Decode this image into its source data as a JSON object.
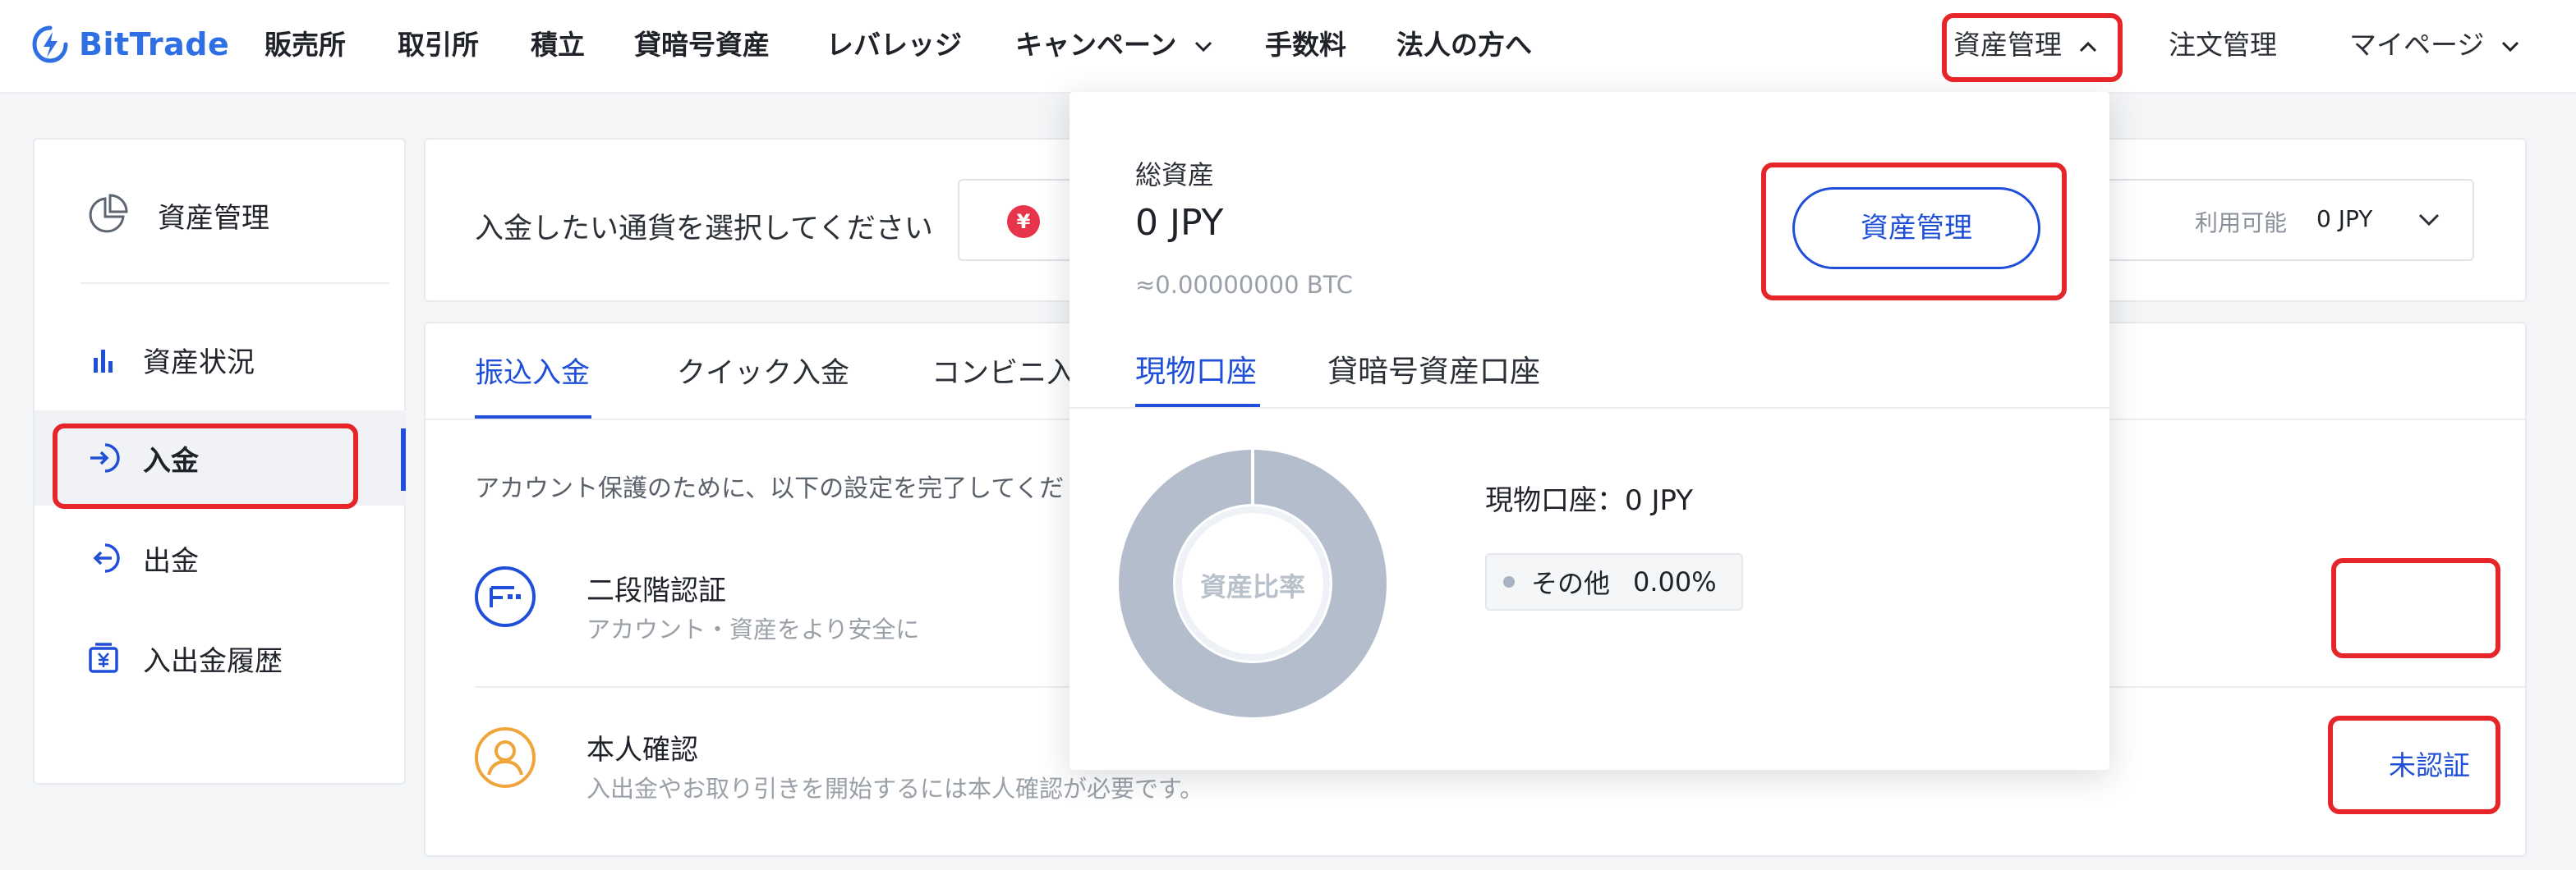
{
  "brand": {
    "name": "BitTrade",
    "color": "#2f6fe4"
  },
  "nav": {
    "items": [
      "販売所",
      "取引所",
      "積立",
      "貸暗号資産",
      "レバレッジ",
      "キャンペーン",
      "手数料",
      "法人の方へ"
    ],
    "right": {
      "assets": "資産管理",
      "orders": "注文管理",
      "mypage": "マイページ"
    }
  },
  "sidebar": {
    "header": "資産管理",
    "items": [
      {
        "label": "資産状況",
        "icon": "bar-chart-icon"
      },
      {
        "label": "入金",
        "icon": "deposit-icon",
        "active": true
      },
      {
        "label": "出金",
        "icon": "withdraw-icon"
      },
      {
        "label": "入出金履歴",
        "icon": "history-icon"
      }
    ]
  },
  "deposit": {
    "select_label": "入金したい通貨を選択してください",
    "currency_symbol": "¥",
    "available_label": "利用可能",
    "available_value": "0 JPY",
    "tabs": [
      "振込入金",
      "クイック入金",
      "コンビニ入"
    ],
    "protect_message": "アカウント保護のために、以下の設定を完了してくだ",
    "twofa": {
      "title": "二段階認証",
      "subtitle": "アカウント・資産をより安全に",
      "status_icon": "check-circle-icon"
    },
    "kyc": {
      "title": "本人確認",
      "subtitle": "入出金やお取り引きを開始するには本人確認が必要です。",
      "status": "未認証"
    }
  },
  "dropdown": {
    "total_label": "総資産",
    "total_value": "0 JPY",
    "btc_value": "≈0.00000000 BTC",
    "button_label": "資産管理",
    "tabs": [
      "現物口座",
      "貸暗号資産口座"
    ],
    "donut_label": "資産比率",
    "spot_line": "現物口座：0 JPY",
    "legend": {
      "name": "その他",
      "pct": "0.00%"
    }
  },
  "colors": {
    "accent": "#1f4fd8",
    "highlight": "#e5252a",
    "warning": "#f0a53a",
    "yen": "#e8344a"
  }
}
